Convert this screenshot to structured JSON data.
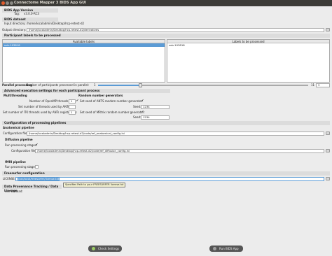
{
  "window": {
    "title": "Connectome Mapper 3 BIDS App GUI"
  },
  "bids_app_version": {
    "section": "BIDS App Version",
    "tag_label": "Tag:",
    "tag_value": "v3.0.0-RC3"
  },
  "bids_dataset": {
    "section": "BIDS dataset",
    "input_label": "Input directory:",
    "input_value": "/home/localadmin/Desktop/hcp-retest-d2",
    "output_label": "Output directory:",
    "output_value": "/home/localadmin/Desktop/hcp-retest-d2/derivatives"
  },
  "participants": {
    "section": "Participant labels to be processed",
    "available_header": "Available labels",
    "available_items": [
      "sub-103818"
    ],
    "selected_header": "Labels to be processed",
    "selected_items": [
      "sub-103818"
    ]
  },
  "parallel": {
    "section": "Parallel processing",
    "label": "Number of participants processed in parallel:",
    "min": "1",
    "max": "11",
    "value": "3",
    "slider_fraction": 0.2
  },
  "advanced": {
    "section": "Advanced execution settings for each participant process",
    "multithreading": "Multithreading",
    "openmp_label": "Number of OpenMP threads:",
    "openmp_value": "1",
    "ants_threads_label": "Set number of threads used by ANTs:",
    "ants_threads_value": "",
    "itk_label": "Set number of ITK threads used by ANTs registration:",
    "itk_value": "1",
    "rng": "Random number generators",
    "ants_seed_label": "Set seed of ANTS random number generator:",
    "ants_seed_checked": "✔",
    "ants_seed_label2": "Seed:",
    "ants_seed_value": "1234",
    "mrtrix_seed_label": "Set seed of MRtrix random number generator:",
    "mrtrix_seed_checked": "✔",
    "mrtrix_seed_label2": "Seed:",
    "mrtrix_seed_value": "1234"
  },
  "pipelines": {
    "section": "Configuration of processing pipelines",
    "anatomical": "Anatomical pipeline",
    "anat_config_label": "Configuration file:",
    "anat_config_value": "/home/localadmin/Desktop/hcp-retest-d2/code/ref_anatomical_config.ini",
    "diffusion": "Diffusion pipeline",
    "diff_run_label": "Run processing stages:",
    "diff_run_checked": "✔",
    "diff_config_label": "Configuration file:",
    "diff_config_value": "/home/localadmin/Desktop/hcp-retest-d2/code/ref_diffusion_config.ini",
    "fmri": "fMRI pipeline",
    "fmri_run_label": "Run processing stages:",
    "fmri_run_checked": ""
  },
  "freesurfer": {
    "section": "Freesurfer configuration",
    "license_label": "LICENSE:",
    "license_value": "/usr/local/freesurfer/license.txt",
    "tooltip": "Specifies Path to your FREESURFER license.txt"
  },
  "provenance": {
    "section": "Data Provenance Tracking / Data Lineage",
    "datalad_label": "Use Datalad:"
  },
  "buttons": {
    "check": "Check Settings",
    "run": "Run BIDS App"
  },
  "colors": {
    "titlebar": "#3c3b37",
    "selection": "#5b9bd5",
    "section_bg": "#dcdcdc"
  }
}
